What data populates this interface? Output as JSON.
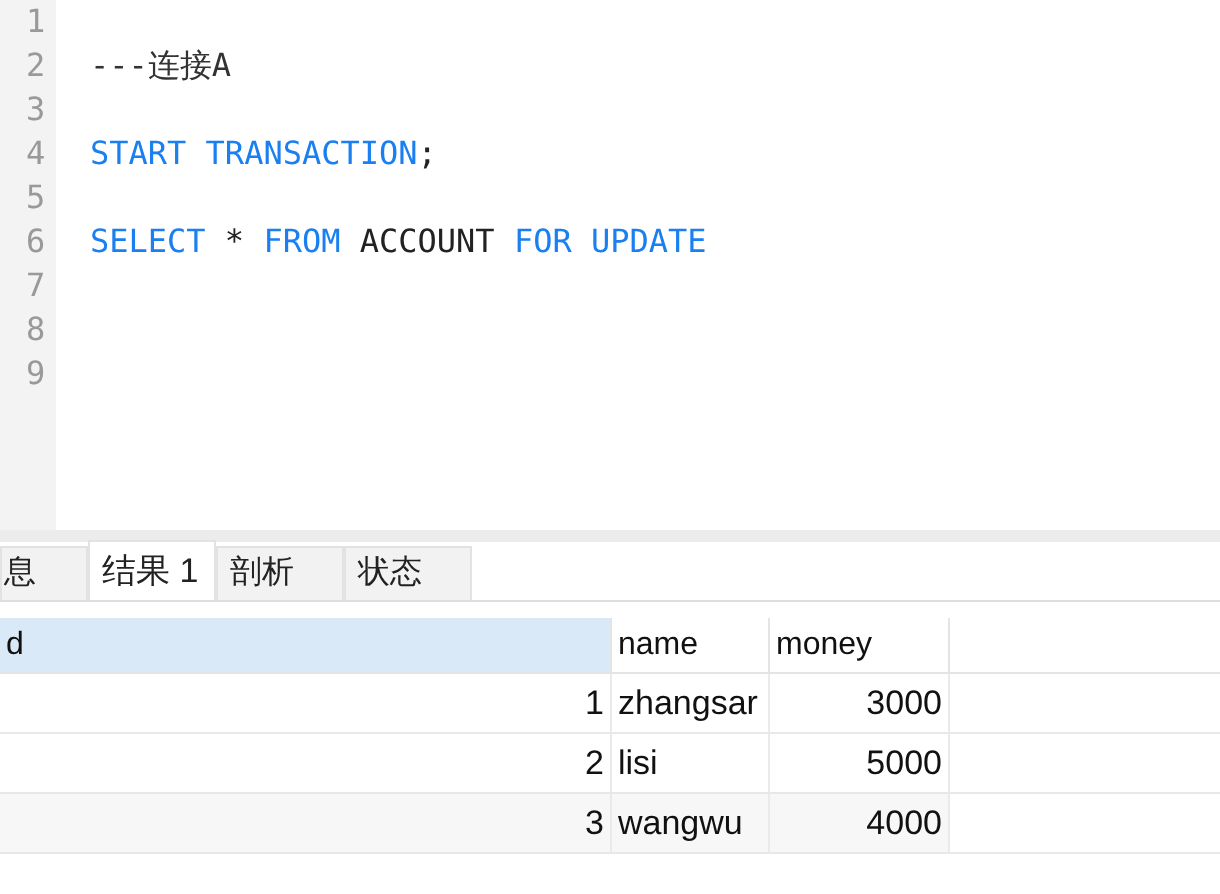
{
  "editor": {
    "lines": [
      {
        "number": "1"
      },
      {
        "number": "2",
        "tokens": [
          {
            "kind": "comment",
            "text": "---连接A"
          }
        ]
      },
      {
        "number": "3"
      },
      {
        "number": "4",
        "tokens": [
          {
            "kind": "keyword",
            "text": "START TRANSACTION"
          },
          {
            "kind": "plain",
            "text": ";"
          }
        ]
      },
      {
        "number": "5"
      },
      {
        "number": "6",
        "tokens": [
          {
            "kind": "keyword",
            "text": "SELECT"
          },
          {
            "kind": "plain",
            "text": " * "
          },
          {
            "kind": "keyword",
            "text": "FROM"
          },
          {
            "kind": "plain",
            "text": " ACCOUNT "
          },
          {
            "kind": "keyword",
            "text": "FOR UPDATE"
          }
        ]
      },
      {
        "number": "7"
      },
      {
        "number": "8"
      },
      {
        "number": "9"
      }
    ]
  },
  "tabs": [
    {
      "label": "息",
      "selected": false
    },
    {
      "label": "结果 1",
      "selected": true
    },
    {
      "label": "剖析",
      "selected": false
    },
    {
      "label": "状态",
      "selected": false
    }
  ],
  "table": {
    "columns": [
      {
        "label": "d",
        "selected": true
      },
      {
        "label": "name",
        "selected": false
      },
      {
        "label": "money",
        "selected": false
      }
    ],
    "rows": [
      [
        "1",
        "zhangsar",
        "3000"
      ],
      [
        "2",
        "lisi",
        "5000"
      ],
      [
        "3",
        "wangwu",
        "4000"
      ]
    ]
  }
}
